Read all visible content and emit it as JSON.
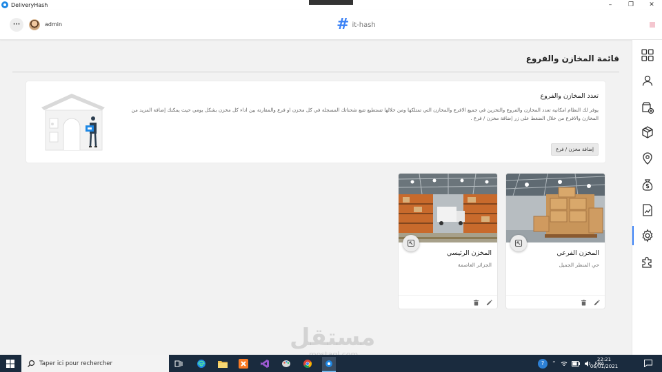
{
  "window": {
    "title": "DeliveryHash",
    "minimize": "–",
    "maximize": "❐",
    "close": "✕"
  },
  "header": {
    "menu_label": "···",
    "user_name": "admin",
    "brand_hash": "#",
    "brand_name": "it-hash"
  },
  "page": {
    "title": "قائمة المخازن والفروع",
    "info_heading": "تعدد المخازن والفروع",
    "info_description": "يوفر لك النظام امكانية تعدد المخازن والفروع والتخزين في جميع الافرع والمخازن التي تمتلكها ومن خلالها تستطيع تتبع شحناتك المسجلة في كل مخزن او فرع والمقارنة بين اداء كل مخزن بشكل يومي حيث يمكنك إضافة المزيد من المخازن والافرع من خلال الضغط على زر إضافة مخزن / فرع .",
    "add_button": "إضافة مخزن / فرع"
  },
  "warehouses": [
    {
      "name": "المخزن الفرعي",
      "address": "حي المنظر الجميل"
    },
    {
      "name": "المخزن الرئيسي",
      "address": "الجزائر العاصمة"
    }
  ],
  "sidebar": {
    "items": [
      {
        "icon": "dashboard-icon"
      },
      {
        "icon": "user-icon"
      },
      {
        "icon": "add-shipment-icon"
      },
      {
        "icon": "package-icon"
      },
      {
        "icon": "location-pin-icon"
      },
      {
        "icon": "money-bag-icon"
      },
      {
        "icon": "report-chart-icon"
      },
      {
        "icon": "gear-icon",
        "active": true
      },
      {
        "icon": "puzzle-icon"
      }
    ],
    "accent": "#3b82f6"
  },
  "watermark": {
    "main": "مستقل",
    "sub": "mostaql.com"
  },
  "taskbar": {
    "search_placeholder": "Taper ici pour rechercher",
    "language": "FRA",
    "time": "22:21",
    "date": "06/01/2021"
  }
}
